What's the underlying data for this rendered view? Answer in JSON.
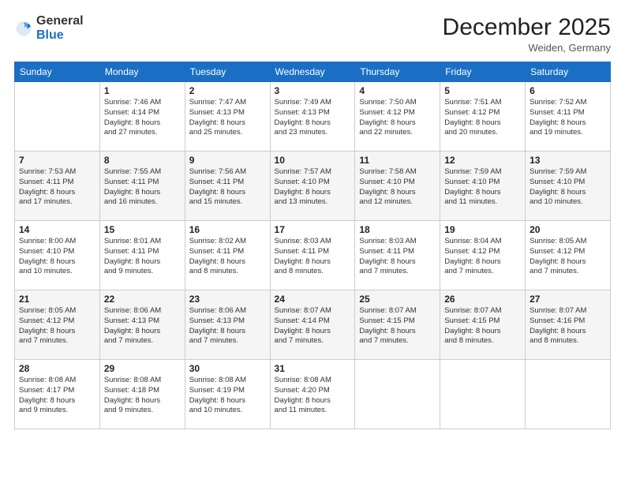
{
  "header": {
    "logo_general": "General",
    "logo_blue": "Blue",
    "month_title": "December 2025",
    "location": "Weiden, Germany"
  },
  "days_of_week": [
    "Sunday",
    "Monday",
    "Tuesday",
    "Wednesday",
    "Thursday",
    "Friday",
    "Saturday"
  ],
  "weeks": [
    [
      {
        "day": "",
        "info": ""
      },
      {
        "day": "1",
        "info": "Sunrise: 7:46 AM\nSunset: 4:14 PM\nDaylight: 8 hours\nand 27 minutes."
      },
      {
        "day": "2",
        "info": "Sunrise: 7:47 AM\nSunset: 4:13 PM\nDaylight: 8 hours\nand 25 minutes."
      },
      {
        "day": "3",
        "info": "Sunrise: 7:49 AM\nSunset: 4:13 PM\nDaylight: 8 hours\nand 23 minutes."
      },
      {
        "day": "4",
        "info": "Sunrise: 7:50 AM\nSunset: 4:12 PM\nDaylight: 8 hours\nand 22 minutes."
      },
      {
        "day": "5",
        "info": "Sunrise: 7:51 AM\nSunset: 4:12 PM\nDaylight: 8 hours\nand 20 minutes."
      },
      {
        "day": "6",
        "info": "Sunrise: 7:52 AM\nSunset: 4:11 PM\nDaylight: 8 hours\nand 19 minutes."
      }
    ],
    [
      {
        "day": "7",
        "info": "Sunrise: 7:53 AM\nSunset: 4:11 PM\nDaylight: 8 hours\nand 17 minutes."
      },
      {
        "day": "8",
        "info": "Sunrise: 7:55 AM\nSunset: 4:11 PM\nDaylight: 8 hours\nand 16 minutes."
      },
      {
        "day": "9",
        "info": "Sunrise: 7:56 AM\nSunset: 4:11 PM\nDaylight: 8 hours\nand 15 minutes."
      },
      {
        "day": "10",
        "info": "Sunrise: 7:57 AM\nSunset: 4:10 PM\nDaylight: 8 hours\nand 13 minutes."
      },
      {
        "day": "11",
        "info": "Sunrise: 7:58 AM\nSunset: 4:10 PM\nDaylight: 8 hours\nand 12 minutes."
      },
      {
        "day": "12",
        "info": "Sunrise: 7:59 AM\nSunset: 4:10 PM\nDaylight: 8 hours\nand 11 minutes."
      },
      {
        "day": "13",
        "info": "Sunrise: 7:59 AM\nSunset: 4:10 PM\nDaylight: 8 hours\nand 10 minutes."
      }
    ],
    [
      {
        "day": "14",
        "info": "Sunrise: 8:00 AM\nSunset: 4:10 PM\nDaylight: 8 hours\nand 10 minutes."
      },
      {
        "day": "15",
        "info": "Sunrise: 8:01 AM\nSunset: 4:11 PM\nDaylight: 8 hours\nand 9 minutes."
      },
      {
        "day": "16",
        "info": "Sunrise: 8:02 AM\nSunset: 4:11 PM\nDaylight: 8 hours\nand 8 minutes."
      },
      {
        "day": "17",
        "info": "Sunrise: 8:03 AM\nSunset: 4:11 PM\nDaylight: 8 hours\nand 8 minutes."
      },
      {
        "day": "18",
        "info": "Sunrise: 8:03 AM\nSunset: 4:11 PM\nDaylight: 8 hours\nand 7 minutes."
      },
      {
        "day": "19",
        "info": "Sunrise: 8:04 AM\nSunset: 4:12 PM\nDaylight: 8 hours\nand 7 minutes."
      },
      {
        "day": "20",
        "info": "Sunrise: 8:05 AM\nSunset: 4:12 PM\nDaylight: 8 hours\nand 7 minutes."
      }
    ],
    [
      {
        "day": "21",
        "info": "Sunrise: 8:05 AM\nSunset: 4:12 PM\nDaylight: 8 hours\nand 7 minutes."
      },
      {
        "day": "22",
        "info": "Sunrise: 8:06 AM\nSunset: 4:13 PM\nDaylight: 8 hours\nand 7 minutes."
      },
      {
        "day": "23",
        "info": "Sunrise: 8:06 AM\nSunset: 4:13 PM\nDaylight: 8 hours\nand 7 minutes."
      },
      {
        "day": "24",
        "info": "Sunrise: 8:07 AM\nSunset: 4:14 PM\nDaylight: 8 hours\nand 7 minutes."
      },
      {
        "day": "25",
        "info": "Sunrise: 8:07 AM\nSunset: 4:15 PM\nDaylight: 8 hours\nand 7 minutes."
      },
      {
        "day": "26",
        "info": "Sunrise: 8:07 AM\nSunset: 4:15 PM\nDaylight: 8 hours\nand 8 minutes."
      },
      {
        "day": "27",
        "info": "Sunrise: 8:07 AM\nSunset: 4:16 PM\nDaylight: 8 hours\nand 8 minutes."
      }
    ],
    [
      {
        "day": "28",
        "info": "Sunrise: 8:08 AM\nSunset: 4:17 PM\nDaylight: 8 hours\nand 9 minutes."
      },
      {
        "day": "29",
        "info": "Sunrise: 8:08 AM\nSunset: 4:18 PM\nDaylight: 8 hours\nand 9 minutes."
      },
      {
        "day": "30",
        "info": "Sunrise: 8:08 AM\nSunset: 4:19 PM\nDaylight: 8 hours\nand 10 minutes."
      },
      {
        "day": "31",
        "info": "Sunrise: 8:08 AM\nSunset: 4:20 PM\nDaylight: 8 hours\nand 11 minutes."
      },
      {
        "day": "",
        "info": ""
      },
      {
        "day": "",
        "info": ""
      },
      {
        "day": "",
        "info": ""
      }
    ]
  ]
}
